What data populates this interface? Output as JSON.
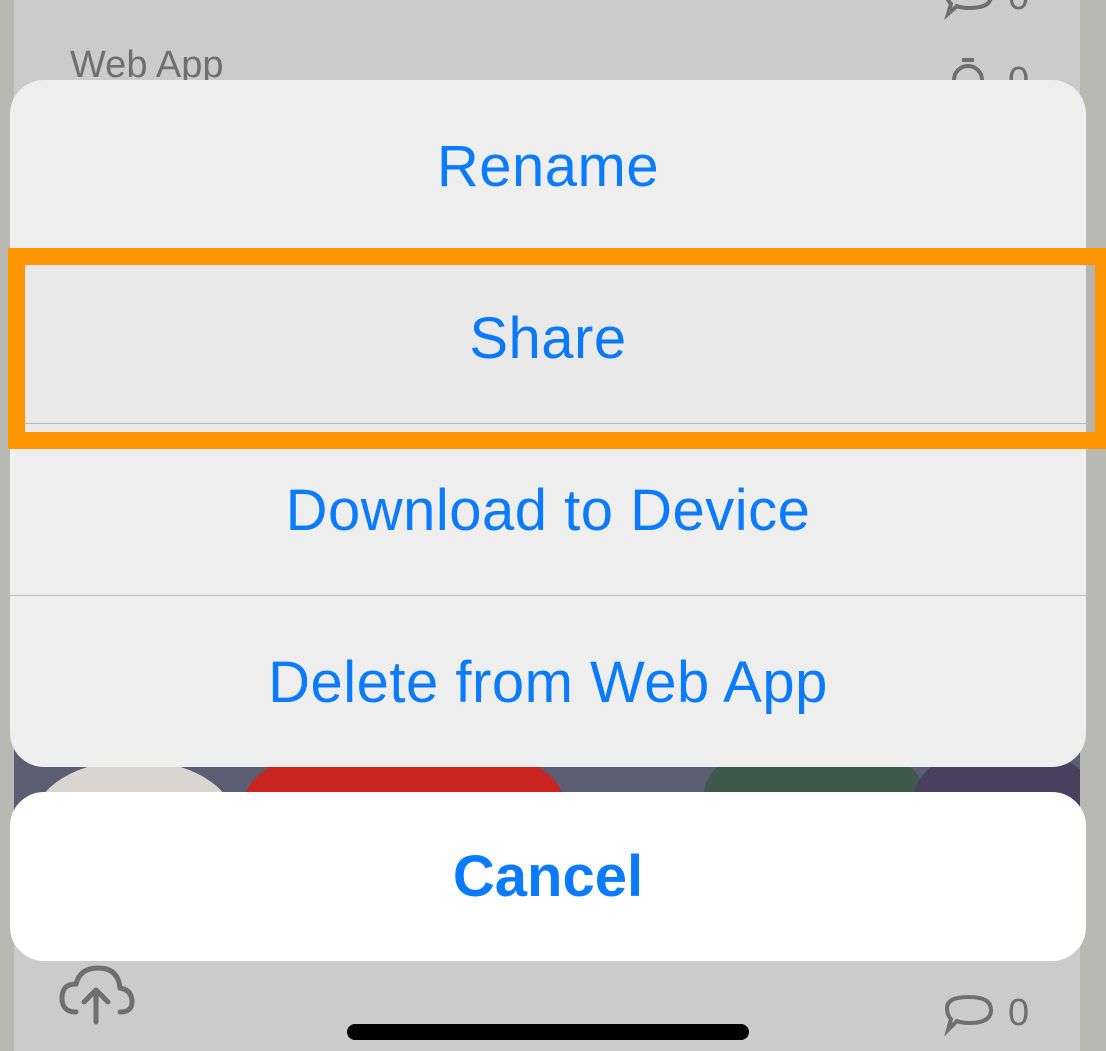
{
  "background": {
    "top_item_label": "Web App",
    "comment_count_top": "0",
    "timer_count_top": "0",
    "comment_count_bottom": "0",
    "icons": [
      "cloud-upload-icon",
      "comment-icon",
      "timer-icon"
    ]
  },
  "action_sheet": {
    "items": [
      {
        "label": "Rename"
      },
      {
        "label": "Share",
        "highlighted": true
      },
      {
        "label": "Download to Device"
      },
      {
        "label": "Delete from Web App"
      }
    ],
    "cancel_label": "Cancel"
  },
  "colors": {
    "action_blue": "#0a7bff",
    "highlight_orange": "#ff9500",
    "sheet_background": "#eeeeee"
  }
}
